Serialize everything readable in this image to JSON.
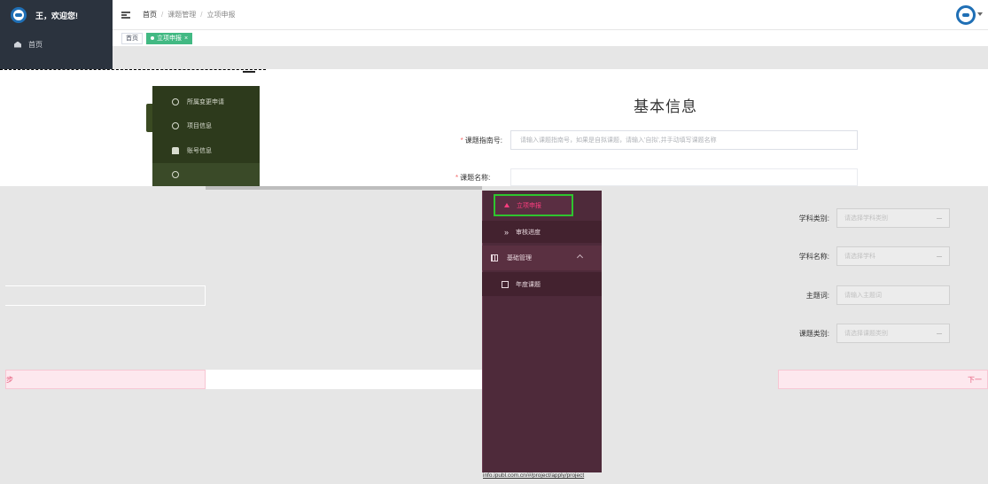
{
  "sidebar": {
    "welcome": "王，欢迎您!",
    "home": "首页"
  },
  "header": {
    "breadcrumb": [
      "首页",
      "课题管理",
      "立项申报"
    ]
  },
  "tags": [
    "首页",
    "立项申报"
  ],
  "form": {
    "title": "基本信息",
    "guide_label": "课题指南号:",
    "guide_placeholder": "请输入课题指南号，如果是自拟课题，请输入'自拟',并手动填写课题名称",
    "name_label": "课题名称:"
  },
  "floating_menu": {
    "items": [
      "所属变更申请",
      "项目信息",
      "账号信息"
    ]
  },
  "dropdown_menu": {
    "apply": "立项申报",
    "progress": "审核进度",
    "basic": "基础管理",
    "year": "年度课题"
  },
  "right_fields": [
    {
      "label": "学科类别:",
      "placeholder": "请选择学科类别"
    },
    {
      "label": "学科名称:",
      "placeholder": "请选择学科"
    },
    {
      "label": "主题词:",
      "placeholder": "请输入主题词"
    },
    {
      "label": "课题类别:",
      "placeholder": "请选择课题类别"
    }
  ],
  "buttons": {
    "prev_fragment": "步",
    "next_fragment": "下一"
  },
  "status_url": "info.ipubl.com.cn/#/project/apply/project",
  "colors": {
    "sidebar": "#2b333e",
    "active_tag": "#42b983",
    "menu_bg": "#4e2a3a",
    "menu_active_text": "#ff3d7f",
    "highlight_border": "#2fc52f"
  }
}
